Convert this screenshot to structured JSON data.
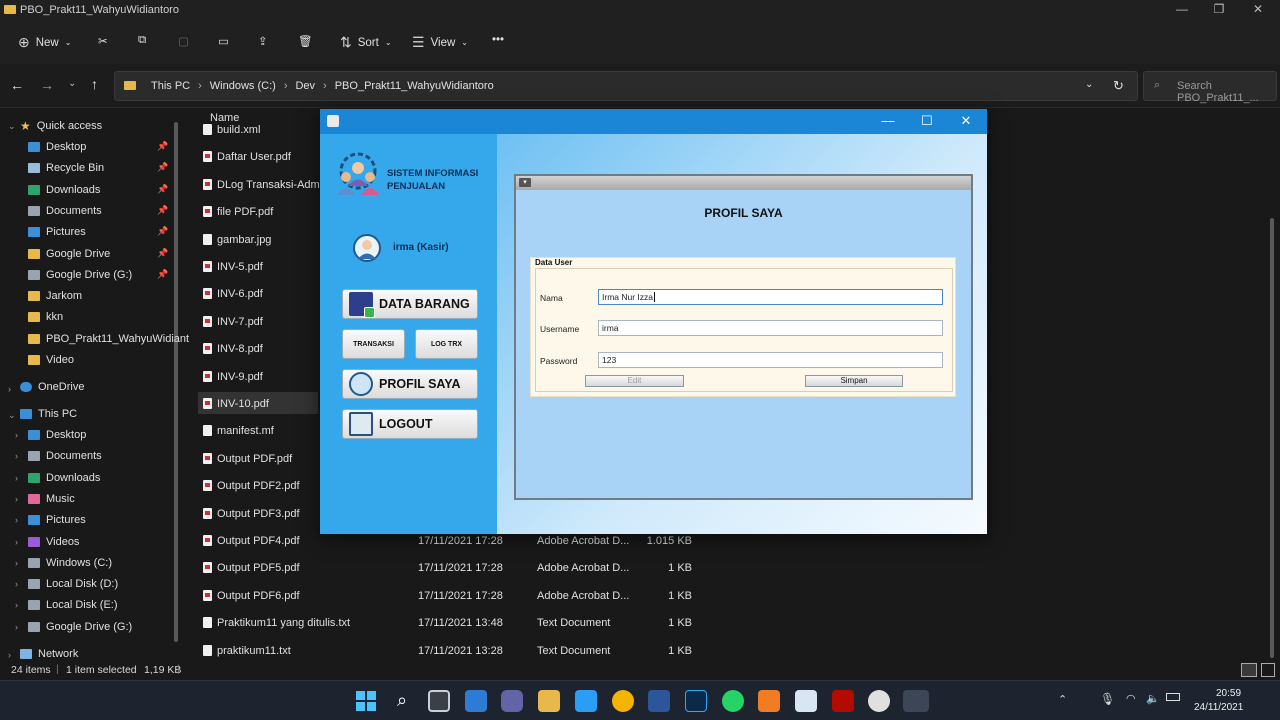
{
  "explorer": {
    "title": "PBO_Prakt11_WahyuWidiantoro",
    "commands": {
      "new": "New",
      "sort": "Sort",
      "view": "View",
      "more": "•••"
    },
    "breadcrumb": [
      "This PC",
      "Windows (C:)",
      "Dev",
      "PBO_Prakt11_WahyuWidiantoro"
    ],
    "search_placeholder": "Search PBO_Prakt11_...",
    "column_name": "Name",
    "quick_access_label": "Quick access",
    "quick_access": [
      {
        "label": "Desktop",
        "icon": "desktop-icon",
        "color": "#3a8fd6"
      },
      {
        "label": "Recycle Bin",
        "icon": "recycle-bin-icon",
        "color": "#9bbbd8"
      },
      {
        "label": "Downloads",
        "icon": "downloads-icon",
        "color": "#2fa36b"
      },
      {
        "label": "Documents",
        "icon": "documents-icon",
        "color": "#9aa4b0"
      },
      {
        "label": "Pictures",
        "icon": "pictures-icon",
        "color": "#3a8fd6"
      },
      {
        "label": "Google Drive",
        "icon": "google-drive-icon",
        "color": "#e8b94a"
      },
      {
        "label": "Google Drive (G:)",
        "icon": "drive-icon",
        "color": "#9aa4b0"
      },
      {
        "label": "Jarkom",
        "icon": "folder-icon",
        "color": "#e8b94a"
      },
      {
        "label": "kkn",
        "icon": "folder-icon",
        "color": "#e8b94a"
      },
      {
        "label": "PBO_Prakt11_WahyuWidiant",
        "icon": "folder-icon",
        "color": "#e8b94a"
      },
      {
        "label": "Video",
        "icon": "folder-icon",
        "color": "#e8b94a"
      }
    ],
    "onedrive_label": "OneDrive",
    "thispc_label": "This PC",
    "thispc": [
      {
        "label": "Desktop",
        "icon": "desktop-icon",
        "color": "#3a8fd6"
      },
      {
        "label": "Documents",
        "icon": "documents-icon",
        "color": "#9aa4b0"
      },
      {
        "label": "Downloads",
        "icon": "downloads-icon",
        "color": "#2fa36b"
      },
      {
        "label": "Music",
        "icon": "music-icon",
        "color": "#e0689a"
      },
      {
        "label": "Pictures",
        "icon": "pictures-icon",
        "color": "#3a8fd6"
      },
      {
        "label": "Videos",
        "icon": "videos-icon",
        "color": "#9b5bd6"
      },
      {
        "label": "Windows (C:)",
        "icon": "drive-icon",
        "color": "#9aa4b0"
      },
      {
        "label": "Local Disk (D:)",
        "icon": "drive-icon",
        "color": "#9aa4b0"
      },
      {
        "label": "Local Disk (E:)",
        "icon": "drive-icon",
        "color": "#9aa4b0"
      },
      {
        "label": "Google Drive (G:)",
        "icon": "drive-icon",
        "color": "#9aa4b0"
      }
    ],
    "network_label": "Network",
    "files": [
      {
        "name": "build.xml",
        "type": "",
        "date": "",
        "size": "",
        "pdf": false
      },
      {
        "name": "Daftar User.pdf",
        "type": "",
        "date": "",
        "size": "",
        "pdf": true
      },
      {
        "name": "DLog Transaksi-Adm.pdf",
        "type": "",
        "date": "",
        "size": "",
        "pdf": true
      },
      {
        "name": "file PDF.pdf",
        "type": "",
        "date": "",
        "size": "",
        "pdf": true
      },
      {
        "name": "gambar.jpg",
        "type": "",
        "date": "",
        "size": "",
        "pdf": false
      },
      {
        "name": "INV-5.pdf",
        "type": "",
        "date": "",
        "size": "",
        "pdf": true
      },
      {
        "name": "INV-6.pdf",
        "type": "",
        "date": "",
        "size": "",
        "pdf": true
      },
      {
        "name": "INV-7.pdf",
        "type": "",
        "date": "",
        "size": "",
        "pdf": true
      },
      {
        "name": "INV-8.pdf",
        "type": "",
        "date": "",
        "size": "",
        "pdf": true
      },
      {
        "name": "INV-9.pdf",
        "type": "",
        "date": "",
        "size": "",
        "pdf": true
      },
      {
        "name": "INV-10.pdf",
        "type": "",
        "date": "",
        "size": "",
        "pdf": true
      },
      {
        "name": "manifest.mf",
        "type": "",
        "date": "",
        "size": "",
        "pdf": false
      },
      {
        "name": "Output PDF.pdf",
        "type": "",
        "date": "",
        "size": "",
        "pdf": true
      },
      {
        "name": "Output PDF2.pdf",
        "type": "",
        "date": "",
        "size": "",
        "pdf": true
      },
      {
        "name": "Output PDF3.pdf",
        "type": "",
        "date": "",
        "size": "",
        "pdf": true
      },
      {
        "name": "Output PDF4.pdf",
        "date": "17/11/2021 17:28",
        "type": "Adobe Acrobat D...",
        "size": "1.015 KB",
        "pdf": true
      },
      {
        "name": "Output PDF5.pdf",
        "date": "17/11/2021 17:28",
        "type": "Adobe Acrobat D...",
        "size": "1 KB",
        "pdf": true
      },
      {
        "name": "Output PDF6.pdf",
        "date": "17/11/2021 17:28",
        "type": "Adobe Acrobat D...",
        "size": "1 KB",
        "pdf": true
      },
      {
        "name": "Praktikum11 yang ditulis.txt",
        "date": "17/11/2021 13:48",
        "type": "Text Document",
        "size": "1 KB",
        "pdf": false
      },
      {
        "name": "praktikum11.txt",
        "date": "17/11/2021 13:28",
        "type": "Text Document",
        "size": "1 KB",
        "pdf": false
      }
    ],
    "status": {
      "items": "24 items",
      "selected": "1 item selected",
      "size": "1,19 KB"
    }
  },
  "app": {
    "brand": "SISTEM INFORMASI PENJUALAN",
    "user": "irma (Kasir)",
    "menu": {
      "data_barang": "DATA BARANG",
      "transaksi": "TRANSAKSI",
      "log_trx": "LOG TRX",
      "profil": "PROFIL SAYA",
      "logout": "LOGOUT"
    },
    "profile": {
      "title": "PROFIL SAYA",
      "group": "Data User",
      "nama_label": "Nama",
      "nama_value": "Irma Nur Izza",
      "username_label": "Username",
      "username_value": "irma",
      "password_label": "Password",
      "password_value": "123",
      "edit": "Edit",
      "simpan": "Simpan"
    }
  },
  "taskbar": {
    "time": "20:59",
    "date": "24/11/2021"
  },
  "colors": {
    "java_title": "#1b86d6",
    "sidebar": "#35a8ec",
    "explorer_bg": "#191919"
  }
}
